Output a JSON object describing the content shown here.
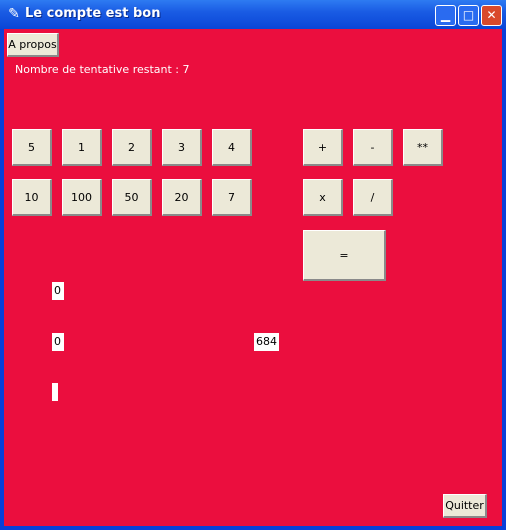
{
  "window": {
    "title": "Le compte est bon",
    "icon": "feather-icon"
  },
  "about_button": "A propos",
  "status": "Nombre de tentative restant : 7",
  "numbers_row1": [
    "5",
    "1",
    "2",
    "3",
    "4"
  ],
  "numbers_row2": [
    "10",
    "100",
    "50",
    "20",
    "7"
  ],
  "ops_row1": [
    "+",
    "-",
    "**"
  ],
  "ops_row2": [
    "x",
    "/"
  ],
  "equals": "=",
  "displays": {
    "first": "0",
    "second": "0",
    "target": "684",
    "third": ""
  },
  "quit_button": "Quitter",
  "colors": {
    "background": "#EB0E3E",
    "button": "#ECE9D8",
    "titlebar": "#0A45D6"
  }
}
